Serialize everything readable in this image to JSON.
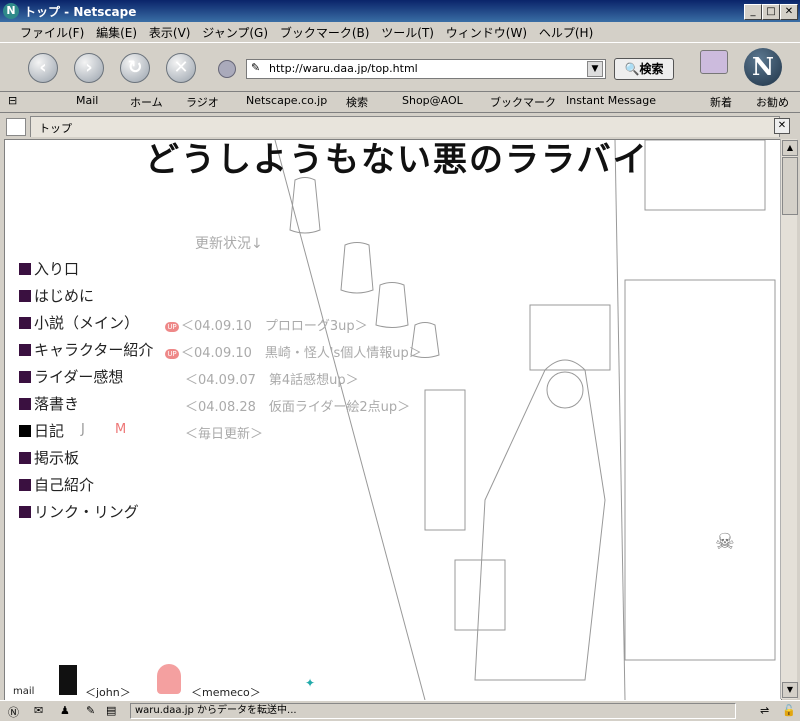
{
  "window": {
    "title": "トップ - Netscape",
    "logo": "N"
  },
  "menu": [
    "ファイル(F)",
    "編集(E)",
    "表示(V)",
    "ジャンプ(G)",
    "ブックマーク(B)",
    "ツール(T)",
    "ウィンドウ(W)",
    "ヘルプ(H)"
  ],
  "nav": {
    "url": "http://waru.daa.jp/top.html",
    "search_label": "検索"
  },
  "personal_toolbar": [
    "Mail",
    "ホーム",
    "ラジオ",
    "Netscape.co.jp",
    "検索",
    "Shop@AOL",
    "ブックマーク",
    "Instant Message",
    "新着",
    "お勧め"
  ],
  "tab": {
    "label": "トップ"
  },
  "page": {
    "title": "どうしようもない悪のララバイ",
    "update_heading": "更新状況↓",
    "items": [
      {
        "label": "入り口"
      },
      {
        "label": "はじめに"
      },
      {
        "label": "小説（メイン）",
        "update": "＜04.09.10　プロローグ3up＞",
        "badge": "UP"
      },
      {
        "label": "キャラクター紹介",
        "update": "＜04.09.10　黒崎・怪人's個人情報up＞",
        "badge": "UP"
      },
      {
        "label": "ライダー感想",
        "update": "＜04.09.07　第4話感想up＞"
      },
      {
        "label": "落書き",
        "update": "＜04.08.28　仮面ライダー絵2点up＞"
      },
      {
        "label": "日記",
        "extra_j": "J",
        "extra_m": "M",
        "update": "＜毎日更新＞"
      },
      {
        "label": "掲示板"
      },
      {
        "label": "自己紹介"
      },
      {
        "label": "リンク・リング"
      }
    ],
    "mail_label": "mail",
    "contact_john": "＜john＞",
    "contact_mememeco": "＜memeco＞"
  },
  "status": {
    "message": "waru.daa.jp からデータを転送中..."
  }
}
